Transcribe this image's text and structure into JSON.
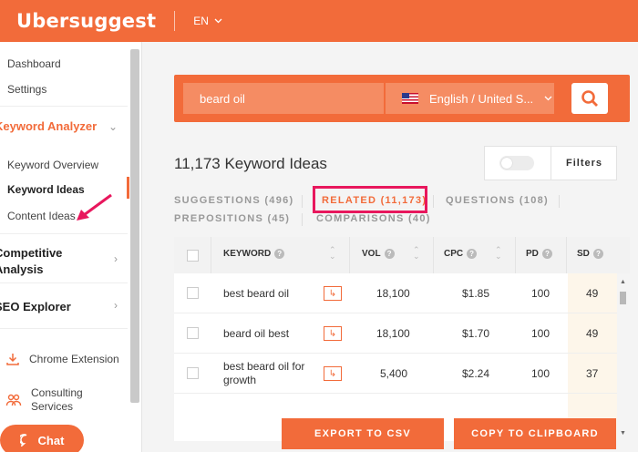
{
  "header": {
    "logo": "Ubersuggest",
    "language": "EN"
  },
  "sidebar": {
    "top_items": [
      {
        "label": "Dashboard"
      },
      {
        "label": "Settings"
      }
    ],
    "keyword_analyzer": {
      "label": "Keyword Analyzer",
      "items": [
        {
          "label": "Keyword Overview"
        },
        {
          "label": "Keyword Ideas",
          "active": true
        },
        {
          "label": "Content Ideas"
        }
      ]
    },
    "competitive_analysis": {
      "line1": "Competitive",
      "line2": "Analysis"
    },
    "seo_explorer": {
      "label": "SEO Explorer"
    },
    "footer": [
      {
        "label": "Chrome Extension",
        "icon": "download-icon"
      },
      {
        "label": "Consulting Services",
        "line1": "Consulting",
        "line2": "Services",
        "icon": "people-icon"
      }
    ],
    "chat": "Chat"
  },
  "search": {
    "query": "beard oil",
    "language_select": "English / United S...",
    "flag": "us-flag"
  },
  "results": {
    "count_label": "11,173 Keyword Ideas",
    "filters_label": "Filters"
  },
  "tabs": [
    {
      "label": "SUGGESTIONS (496)",
      "active": false
    },
    {
      "label": "RELATED (11,173)",
      "active": true
    },
    {
      "label": "QUESTIONS (108)",
      "active": false
    },
    {
      "label": "PREPOSITIONS (45)",
      "active": false
    },
    {
      "label": "COMPARISONS (40)",
      "active": false
    }
  ],
  "table": {
    "columns": [
      "KEYWORD",
      "VOL",
      "CPC",
      "PD",
      "SD"
    ],
    "rows": [
      {
        "keyword": "best beard oil",
        "vol": "18,100",
        "cpc": "$1.85",
        "pd": "100",
        "sd": "49"
      },
      {
        "keyword": "beard oil best",
        "vol": "18,100",
        "cpc": "$1.70",
        "pd": "100",
        "sd": "49"
      },
      {
        "keyword": "best beard oil for growth",
        "vol": "5,400",
        "cpc": "$2.24",
        "pd": "100",
        "sd": "37"
      }
    ]
  },
  "actions": {
    "export": "EXPORT TO CSV",
    "copy": "COPY TO CLIPBOARD"
  },
  "colors": {
    "brand": "#f26b3a",
    "highlight": "#e8175d"
  }
}
